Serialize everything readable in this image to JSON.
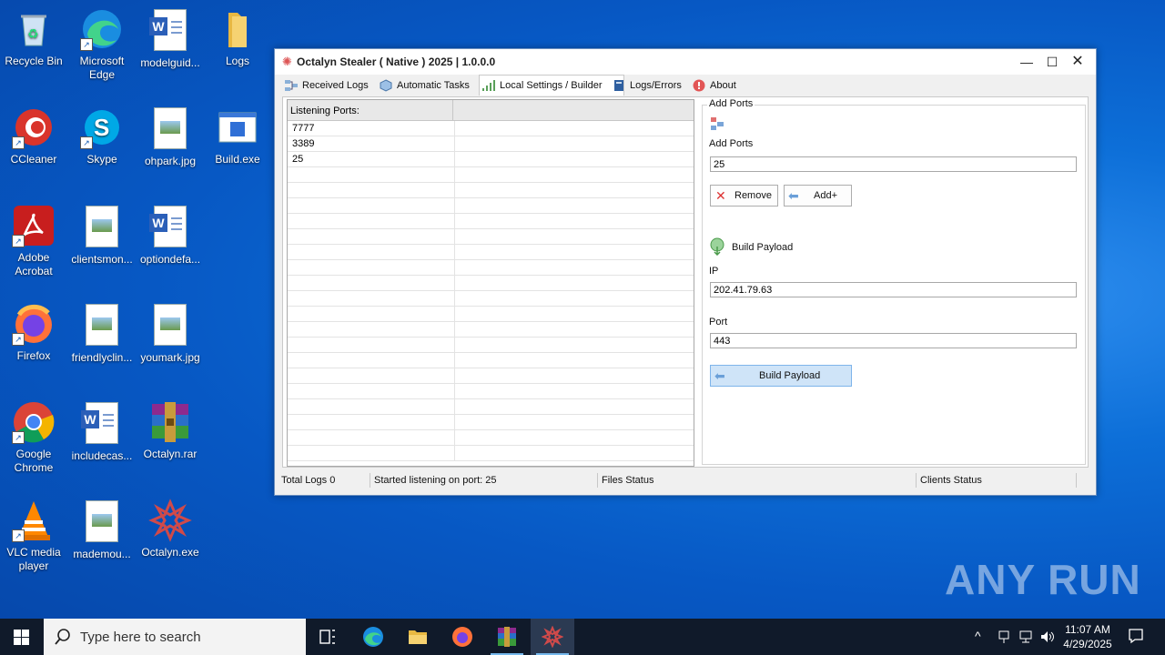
{
  "desktop": {
    "icons": [
      {
        "label": "Recycle Bin"
      },
      {
        "label": "Microsoft Edge"
      },
      {
        "label": "modelguid..."
      },
      {
        "label": "Logs"
      },
      {
        "label": "CCleaner"
      },
      {
        "label": "Skype"
      },
      {
        "label": "ohpark.jpg"
      },
      {
        "label": "Build.exe"
      },
      {
        "label": "Adobe Acrobat"
      },
      {
        "label": "clientsmon..."
      },
      {
        "label": "optiondefa..."
      },
      {
        "label": "Firefox"
      },
      {
        "label": "friendlyclin..."
      },
      {
        "label": "youmark.jpg"
      },
      {
        "label": "Google Chrome"
      },
      {
        "label": "includecas..."
      },
      {
        "label": "Octalyn.rar"
      },
      {
        "label": "VLC media player"
      },
      {
        "label": "mademou..."
      },
      {
        "label": "Octalyn.exe"
      }
    ]
  },
  "window": {
    "title": "Octalyn Stealer ( Native ) 2025 | 1.0.0.0",
    "tabs": [
      {
        "label": "Received Logs"
      },
      {
        "label": "Automatic Tasks"
      },
      {
        "label": "Local Settings / Builder"
      },
      {
        "label": "Logs/Errors"
      },
      {
        "label": "About"
      }
    ],
    "ports_grid": {
      "header": "Listening Ports:",
      "rows": [
        "7777",
        "3389",
        "25"
      ]
    },
    "add_ports": {
      "group_title": "Add Ports",
      "label": "Add Ports",
      "value": "25",
      "remove_label": "Remove",
      "add_label": "Add+"
    },
    "build": {
      "heading": "Build Payload",
      "ip_label": "IP",
      "ip_value": "202.41.79.63",
      "port_label": "Port",
      "port_value": "443",
      "build_label": "Build Payload"
    },
    "status": {
      "total_logs": "Total Logs 0",
      "listening": "Started listening on port: 25",
      "files": "Files Status",
      "clients": "Clients Status"
    }
  },
  "watermark": "ANY RUN",
  "taskbar": {
    "search_placeholder": "Type here to search",
    "time": "11:07 AM",
    "date": "4/29/2025"
  },
  "colors": {
    "accent": "#0a64cc",
    "brand_icon": "#d04a4a"
  }
}
